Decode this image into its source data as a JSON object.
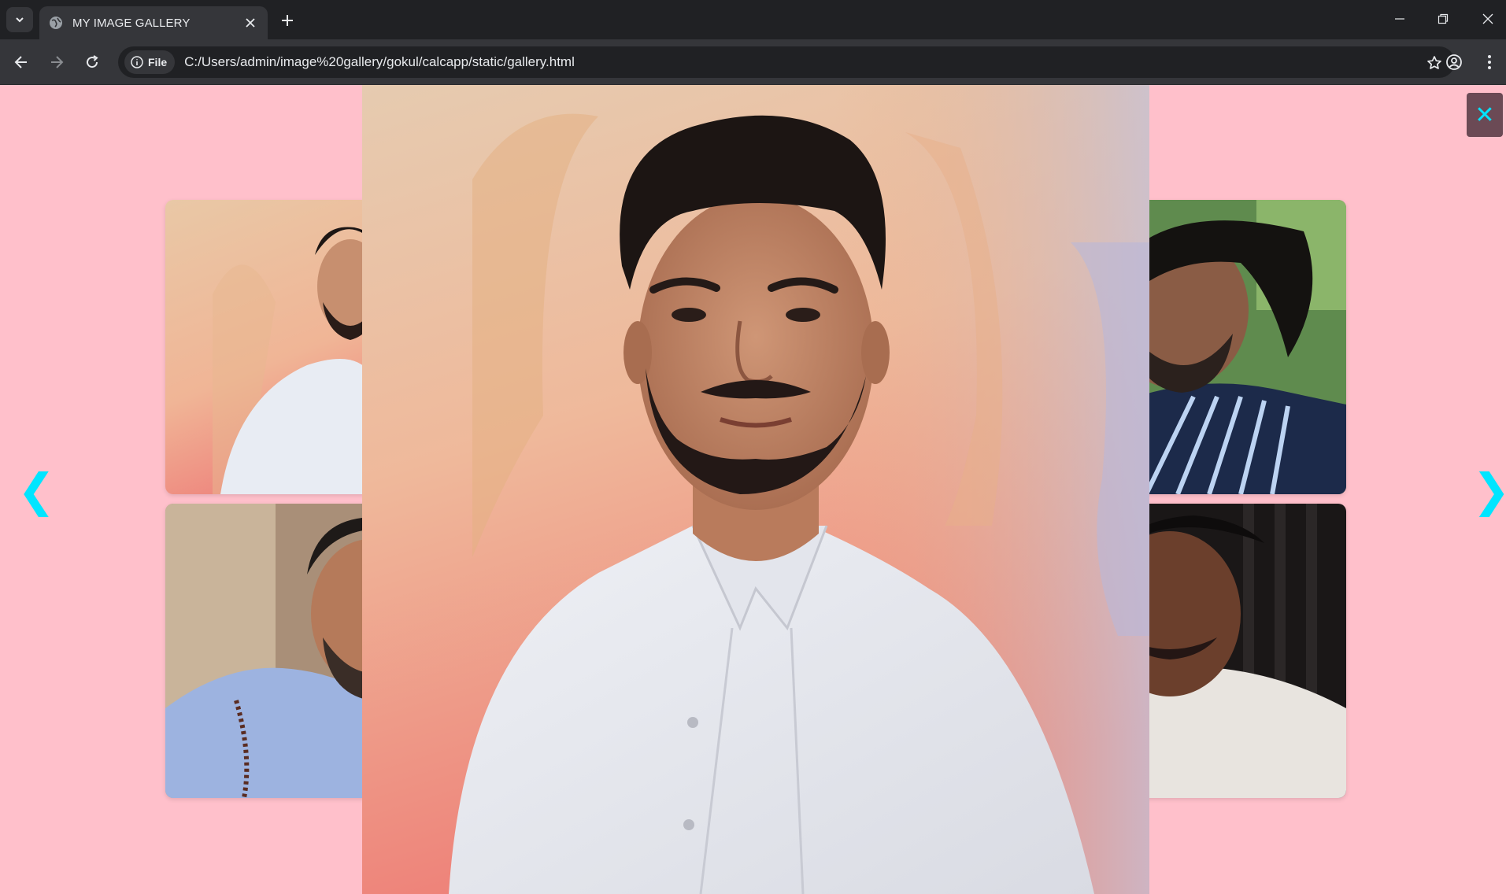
{
  "browser": {
    "tab_title": "MY IMAGE GALLERY",
    "file_chip": "File",
    "url": "C:/Users/admin/image%20gallery/gokul/calcapp/static/gallery.html"
  },
  "gallery": {
    "prev_label": "❮",
    "next_label": "❯",
    "close_label": "✕",
    "accent_color": "#00e5ff",
    "background_color": "#ffc0cb",
    "thumbnails": [
      {
        "position": "top-left"
      },
      {
        "position": "bottom-left"
      },
      {
        "position": "top-right"
      },
      {
        "position": "bottom-right"
      }
    ]
  }
}
